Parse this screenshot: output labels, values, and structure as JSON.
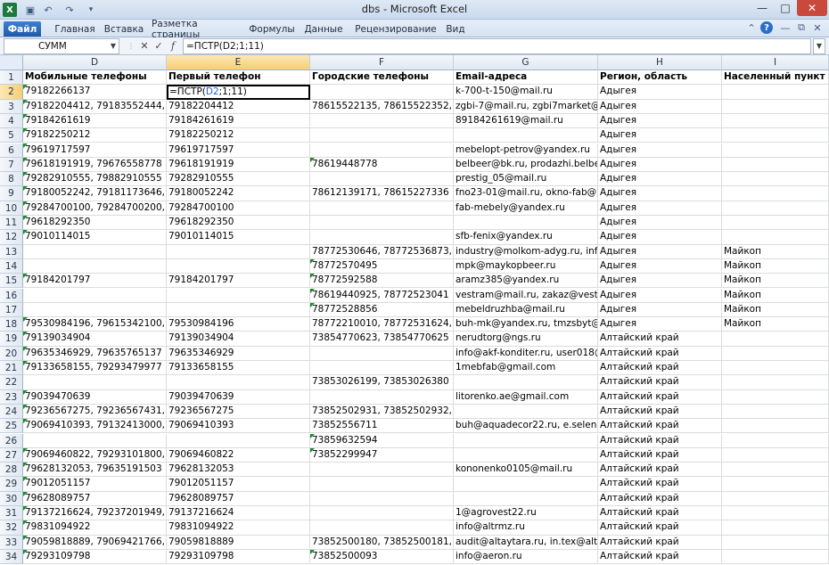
{
  "window": {
    "title": "dbs - Microsoft Excel"
  },
  "ribbon": {
    "tabs": [
      "Файл",
      "Главная",
      "Вставка",
      "Разметка страницы",
      "Формулы",
      "Данные",
      "Рецензирование",
      "Вид"
    ]
  },
  "formula_bar": {
    "name_box": "СУММ",
    "formula": "=ПСТР(D2;1;11)"
  },
  "active_cell": {
    "col": "E",
    "row": 2,
    "before": "=ПСТР(",
    "ref": "D2",
    "after": ";1;11)"
  },
  "columns": [
    "D",
    "E",
    "F",
    "G",
    "H",
    "I"
  ],
  "selected_column": "E",
  "header_row": [
    "Мобильные телефоны",
    "Первый телефон",
    "Городские телефоны",
    "Email-адреса",
    "Регион, область",
    "Населенный пункт"
  ],
  "rows": [
    {
      "n": 2,
      "cells": [
        "79182266137",
        "",
        "",
        "k-700-t-150@mail.ru",
        "Адыгея",
        ""
      ]
    },
    {
      "n": 3,
      "cells": [
        "79182204412, 79183552444, 7918",
        "79182204412",
        "78615522135, 78615522352, 7861",
        "zgbi-7@mail.ru, zgbi7market@m",
        "Адыгея",
        ""
      ]
    },
    {
      "n": 4,
      "cells": [
        "79184261619",
        "79184261619",
        "",
        "89184261619@mail.ru",
        "Адыгея",
        ""
      ]
    },
    {
      "n": 5,
      "cells": [
        "79182250212",
        "79182250212",
        "",
        "",
        "Адыгея",
        ""
      ]
    },
    {
      "n": 6,
      "cells": [
        "79619717597",
        "79619717597",
        "",
        "mebelopt-petrov@yandex.ru",
        "Адыгея",
        ""
      ]
    },
    {
      "n": 7,
      "cells": [
        "79618191919, 79676558778",
        "79618191919",
        "78619448778",
        "belbeer@bk.ru, prodazhi.belbe",
        "Адыгея",
        ""
      ]
    },
    {
      "n": 8,
      "cells": [
        "79282910555, 79882910555",
        "79282910555",
        "",
        "prestig_05@mail.ru",
        "Адыгея",
        ""
      ]
    },
    {
      "n": 9,
      "cells": [
        "79180052242, 79181173646, 7918",
        "79180052242",
        "78612139171, 78615227336",
        "fno23-01@mail.ru, okno-fab@m",
        "Адыгея",
        ""
      ]
    },
    {
      "n": 10,
      "cells": [
        "79284700100, 79284700200, 7928",
        "79284700100",
        "",
        "fab-mebely@yandex.ru",
        "Адыгея",
        ""
      ]
    },
    {
      "n": 11,
      "cells": [
        "79618292350",
        "79618292350",
        "",
        "",
        "Адыгея",
        ""
      ]
    },
    {
      "n": 12,
      "cells": [
        "79010114015",
        "79010114015",
        "",
        "sfb-fenix@yandex.ru",
        "Адыгея",
        ""
      ]
    },
    {
      "n": 13,
      "cells": [
        "",
        "",
        "78772530646, 78772536873, 7877",
        "industry@molkom-adyg.ru, info",
        "Адыгея",
        "Майкоп"
      ]
    },
    {
      "n": 14,
      "cells": [
        "",
        "",
        "78772570495",
        "mpk@maykopbeer.ru",
        "Адыгея",
        "Майкоп"
      ]
    },
    {
      "n": 15,
      "cells": [
        "79184201797",
        "79184201797",
        "78772592588",
        "aramz385@yandex.ru",
        "Адыгея",
        "Майкоп"
      ]
    },
    {
      "n": 16,
      "cells": [
        "",
        "",
        "78619440925, 78772523041",
        "vestram@mail.ru, zakaz@vestra",
        "Адыгея",
        "Майкоп"
      ]
    },
    {
      "n": 17,
      "cells": [
        "",
        "",
        "78772528856",
        "mebeldruzhba@mail.ru",
        "Адыгея",
        "Майкоп"
      ]
    },
    {
      "n": 18,
      "cells": [
        "79530984196, 79615342100, 7961",
        "79530984196",
        "78772210010, 78772531624, 7877",
        "buh-mk@yandex.ru, tmzsbyt@y",
        "Адыгея",
        "Майкоп"
      ]
    },
    {
      "n": 19,
      "cells": [
        "79139034904",
        "79139034904",
        "73854770623, 73854770625",
        "nerudtorg@ngs.ru",
        "Алтайский край",
        ""
      ]
    },
    {
      "n": 20,
      "cells": [
        "79635346929, 79635765137",
        "79635346929",
        "",
        "info@akf-konditer.ru, user018@",
        "Алтайский край",
        ""
      ]
    },
    {
      "n": 21,
      "cells": [
        "79133658155, 79293479977",
        "79133658155",
        "",
        "1mebfab@gmail.com",
        "Алтайский край",
        ""
      ]
    },
    {
      "n": 22,
      "cells": [
        "",
        "",
        "73853026199, 73853026380",
        "",
        "Алтайский край",
        ""
      ]
    },
    {
      "n": 23,
      "cells": [
        "79039470639",
        "79039470639",
        "",
        "litorenko.ae@gmail.com",
        "Алтайский край",
        ""
      ]
    },
    {
      "n": 24,
      "cells": [
        "79236567275, 79236567431, 7923",
        "79236567275",
        "73852502931, 73852502932, 73852503581, 73852503582, 7385250",
        "",
        "Алтайский край",
        ""
      ]
    },
    {
      "n": 25,
      "cells": [
        "79069410393, 79132413000, 7913",
        "79069410393",
        "73852556711",
        "buh@aquadecor22.ru, e.selens",
        "Алтайский край",
        ""
      ]
    },
    {
      "n": 26,
      "cells": [
        "",
        "",
        "73859632594",
        "",
        "Алтайский край",
        ""
      ]
    },
    {
      "n": 27,
      "cells": [
        "79069460822, 79293101800, 7960",
        "79069460822",
        "73852299947",
        "",
        "Алтайский край",
        ""
      ]
    },
    {
      "n": 28,
      "cells": [
        "79628132053, 79635191503",
        "79628132053",
        "",
        "kononenko0105@mail.ru",
        "Алтайский край",
        ""
      ]
    },
    {
      "n": 29,
      "cells": [
        "79012051157",
        "79012051157",
        "",
        "",
        "Алтайский край",
        ""
      ]
    },
    {
      "n": 30,
      "cells": [
        "79628089757",
        "79628089757",
        "",
        "",
        "Алтайский край",
        ""
      ]
    },
    {
      "n": 31,
      "cells": [
        "79137216624, 79237201949, 7923",
        "79137216624",
        "",
        "1@agrovest22.ru",
        "Алтайский край",
        ""
      ]
    },
    {
      "n": 32,
      "cells": [
        "79831094922",
        "79831094922",
        "",
        "info@altrmz.ru",
        "Алтайский край",
        ""
      ]
    },
    {
      "n": 33,
      "cells": [
        "79059818889, 79069421766, 7906",
        "79059818889",
        "73852500180, 73852500181, 7385",
        "audit@altaytara.ru, in.tex@alta",
        "Алтайский край",
        ""
      ]
    },
    {
      "n": 34,
      "cells": [
        "79293109798",
        "79293109798",
        "73852500093",
        "info@aeron.ru",
        "Алтайский край",
        ""
      ]
    }
  ],
  "icons": [
    "excel-logo-icon",
    "save-icon",
    "undo-icon",
    "redo-icon",
    "customize-qat-icon",
    "minimize-icon",
    "maximize-icon",
    "close-icon",
    "help-icon",
    "cancel-formula-icon",
    "enter-formula-icon",
    "insert-function-icon"
  ]
}
